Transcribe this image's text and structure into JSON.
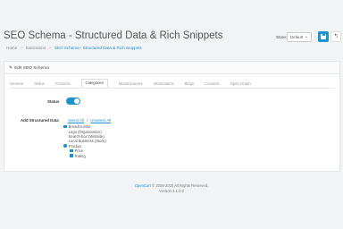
{
  "header": {
    "title": "SEO Schema - Structured Data & Rich Snippets",
    "breadcrumbs": [
      "Home",
      "Extensions",
      "SEO Schema - Structured Data & Rich Snippets"
    ],
    "store_label": "Store:",
    "store_value": "Default",
    "save_icon": "floppy-disk-icon",
    "back_icon": "reply-icon"
  },
  "panel": {
    "heading": "Edit SEO Schema",
    "tabs": [
      "General",
      "Online",
      "Products",
      "Categories",
      "Manufacturers",
      "Informations",
      "Blogs",
      "Contacts",
      "Open Graph"
    ],
    "active_tab": "Categories",
    "status_label": "Status",
    "status_on": true,
    "asd_label": "Add Structured Data",
    "select_all": "Select All",
    "unselect_all": "Unselect All",
    "options": [
      {
        "label": "Breadcrumbs",
        "checked": true
      },
      {
        "label": "Logo (Organization)",
        "checked": false
      },
      {
        "label": "Search box (Website)",
        "checked": false
      },
      {
        "label": "Local Business (Store)",
        "checked": false
      },
      {
        "label": "Product",
        "checked": true,
        "radio": true
      },
      {
        "label": "Price",
        "checked": true,
        "sub": true
      },
      {
        "label": "Rating",
        "checked": true,
        "sub": true
      }
    ]
  },
  "footer": {
    "brand": "OpenCart",
    "copyright": "© 2009-2020 All Rights Reserved.",
    "version": "Version 4.1.0.0"
  },
  "colors": {
    "accent": "#1e91cf",
    "background": "#f1f3f5"
  }
}
